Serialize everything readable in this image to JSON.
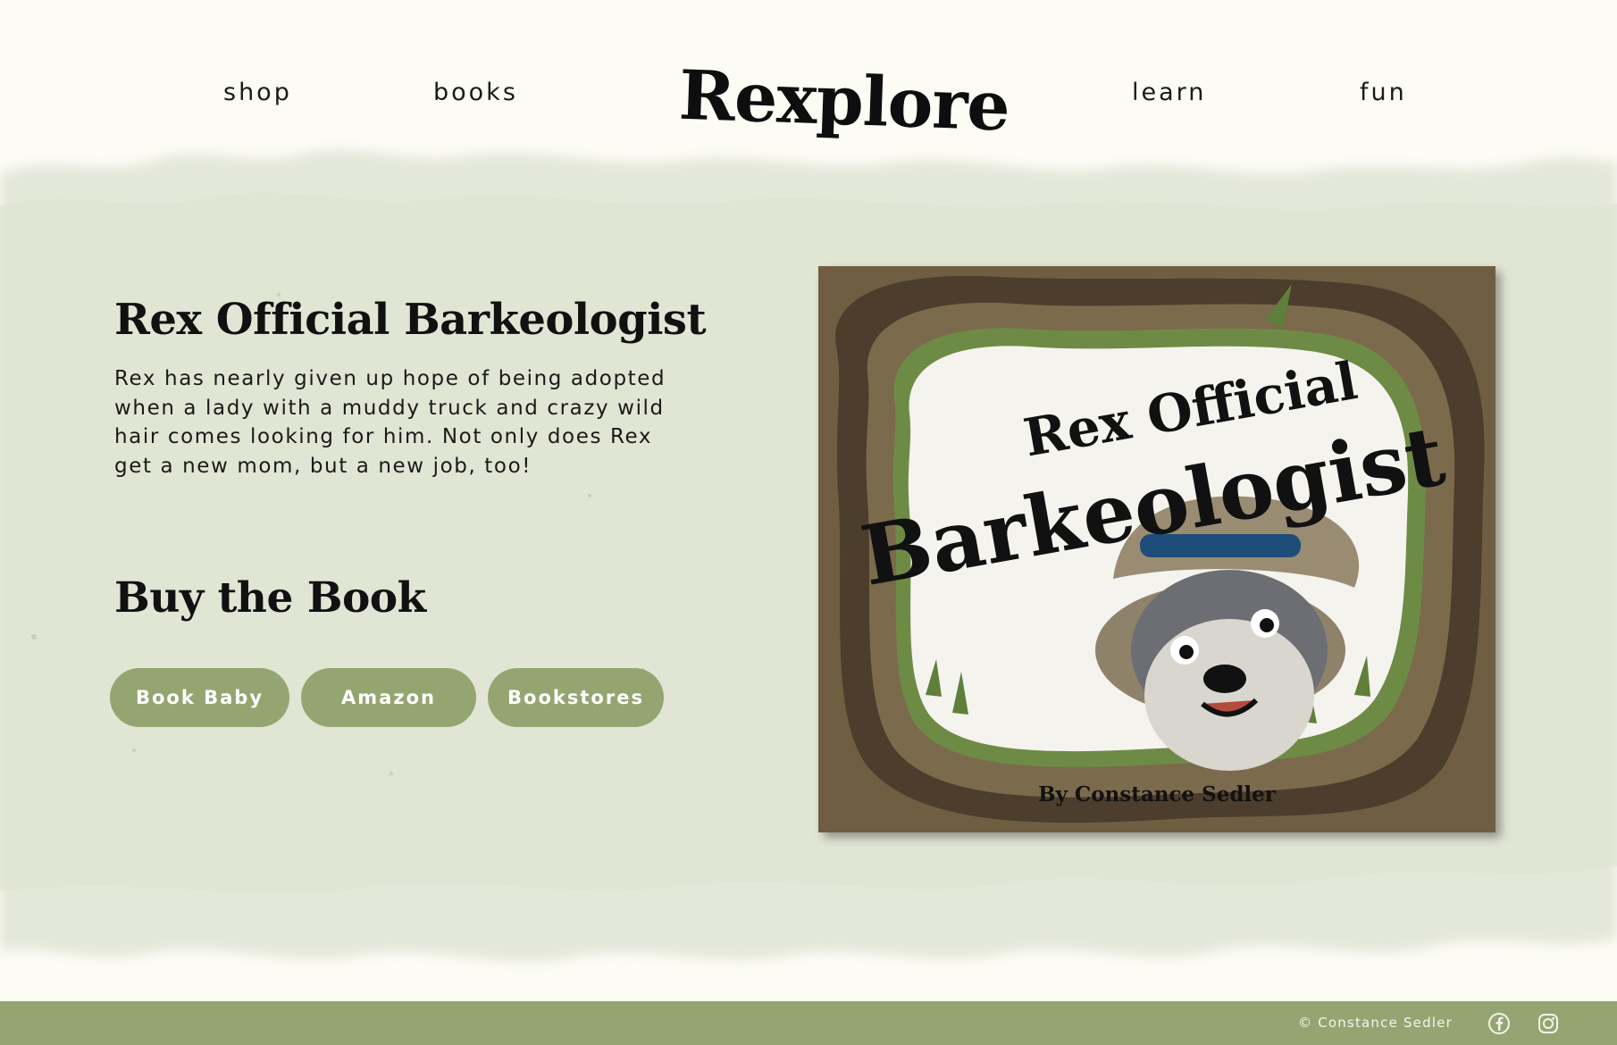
{
  "nav": {
    "shop": "shop",
    "books": "books",
    "logo": "Rexplore",
    "learn": "learn",
    "fun": "fun"
  },
  "book": {
    "title": "Rex Official Barkeologist",
    "description": "Rex has nearly given up hope of being adopted when a lady with a muddy truck and crazy wild hair comes looking for him. Not only does Rex get a new mom, but a new job, too!"
  },
  "buy": {
    "heading": "Buy the Book",
    "buttons": [
      "Book Baby",
      "Amazon",
      "Bookstores"
    ]
  },
  "cover": {
    "title_line1": "Rex Official",
    "title_line2": "Barkeologist",
    "author": "By Constance Sedler"
  },
  "footer": {
    "copyright": "© Constance Sedler",
    "social_icons": [
      "facebook-icon",
      "instagram-icon"
    ]
  },
  "colors": {
    "page_background": "#fcfbf4",
    "band_green": "#e3e7d8",
    "button_green": "#95a571",
    "footer_green": "#95a571",
    "cover_dirt": "#6f5e42"
  }
}
